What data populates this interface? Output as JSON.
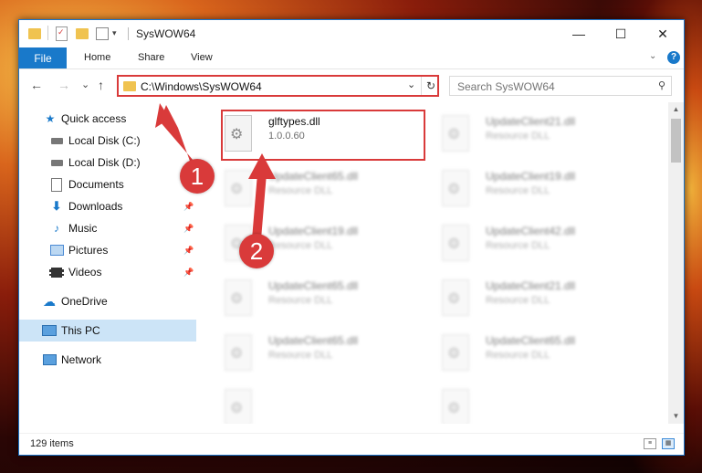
{
  "window": {
    "title": "SysWOW64",
    "minimize_glyph": "—",
    "maximize_glyph": "☐",
    "close_glyph": "✕"
  },
  "ribbon": {
    "file": "File",
    "tabs": [
      "Home",
      "Share",
      "View"
    ],
    "help": "?"
  },
  "navigation": {
    "back": "←",
    "forward": "→",
    "recent": "⌄",
    "up": "↑",
    "address": "C:\\Windows\\SysWOW64",
    "refresh": "↻",
    "search_placeholder": "Search SysWOW64"
  },
  "sidebar": {
    "items": [
      {
        "label": "Quick access",
        "icon": "star-icon"
      },
      {
        "label": "Local Disk (C:)",
        "icon": "drive-icon"
      },
      {
        "label": "Local Disk (D:)",
        "icon": "drive-icon"
      },
      {
        "label": "Documents",
        "icon": "documents-icon"
      },
      {
        "label": "Downloads",
        "icon": "download-icon"
      },
      {
        "label": "Music",
        "icon": "music-icon"
      },
      {
        "label": "Pictures",
        "icon": "pictures-icon"
      },
      {
        "label": "Videos",
        "icon": "videos-icon"
      },
      {
        "label": "OneDrive",
        "icon": "cloud-icon"
      },
      {
        "label": "This PC",
        "icon": "computer-icon"
      },
      {
        "label": "Network",
        "icon": "network-icon"
      }
    ]
  },
  "files": [
    {
      "name": "glftypes.dll",
      "sub": "1.0.0.60"
    },
    {
      "name": "UpdateClient21.dll",
      "sub": "Resource DLL"
    },
    {
      "name": "UpdateClient65.dll",
      "sub": "Resource DLL"
    },
    {
      "name": "UpdateClient19.dll",
      "sub": "Resource DLL"
    },
    {
      "name": "UpdateClient19.dll",
      "sub": "Resource DLL"
    },
    {
      "name": "UpdateClient42.dll",
      "sub": "Resource DLL"
    },
    {
      "name": "UpdateClient65.dll",
      "sub": "Resource DLL"
    },
    {
      "name": "UpdateClient21.dll",
      "sub": "Resource DLL"
    },
    {
      "name": "UpdateClient65.dll",
      "sub": "Resource DLL"
    },
    {
      "name": "UpdateClient65.dll",
      "sub": "Resource DLL"
    }
  ],
  "status": {
    "count": "129 items"
  },
  "annotations": {
    "step1": "1",
    "step2": "2",
    "color": "#d93a3a"
  }
}
